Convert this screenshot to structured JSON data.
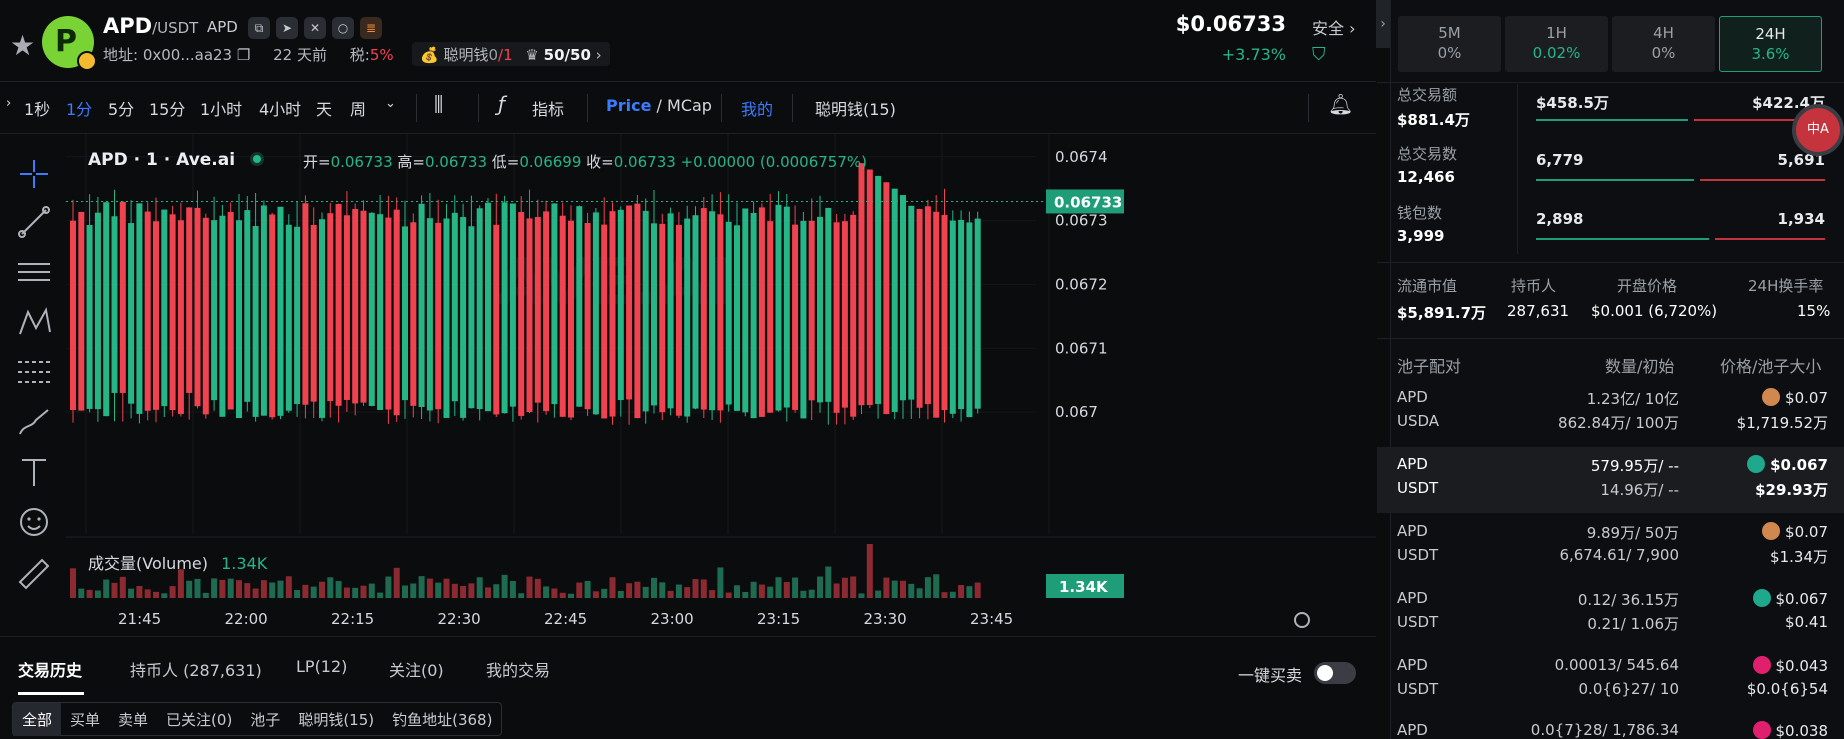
{
  "header": {
    "base": "APD",
    "quote": "/USDT",
    "symbol_tag": "APD",
    "address_label": "地址: 0x00...aa23",
    "age": "22 天前",
    "tax_label": "税:",
    "tax_value": "5%",
    "smart_money_label": "聪明钱",
    "smart_money_a": "0",
    "smart_money_b": "/1",
    "holders_ratio": "50/50",
    "price": "$0.06733",
    "change": "+3.73%",
    "safety": "安全"
  },
  "toolbar": {
    "intervals": [
      "1秒",
      "1分",
      "5分",
      "15分",
      "1小时",
      "4小时",
      "天",
      "周"
    ],
    "active_interval": "1分",
    "indicators": "指标",
    "price_mode": "Price",
    "mcap_mode": "/ MCap",
    "mine": "我的",
    "smart_money": "聪明钱(15)"
  },
  "chart": {
    "legend": "APD · 1 · Ave.ai",
    "open_label": "开=",
    "open": "0.06733",
    "high_label": "高=",
    "high": "0.06733",
    "low_label": "低=",
    "low": "0.06699",
    "close_label": "收=",
    "close": "0.06733",
    "change": "+0.00000 (0.0006757%)",
    "volume_label": "成交量(Volume)",
    "volume_value": "1.34K",
    "current_price_tag": "0.06733",
    "current_volume_tag": "1.34K",
    "watermark": "AVE.AI"
  },
  "chart_data": {
    "type": "candlestick",
    "y_ticks": [
      "0.0674",
      "0.0673",
      "0.0672",
      "0.0671",
      "0.067"
    ],
    "x_ticks": [
      "21:45",
      "22:00",
      "22:15",
      "22:30",
      "22:45",
      "23:00",
      "23:15",
      "23:30",
      "23:45"
    ],
    "ylim": [
      0.06695,
      0.06742
    ],
    "last_close": 0.06733
  },
  "bottom_tabs": {
    "tabs": [
      "交易历史",
      "持币人 (287,631)",
      "LP(12)",
      "关注(0)",
      "我的交易"
    ],
    "quick_trade": "一键买卖",
    "filters": [
      "全部",
      "买单",
      "卖单",
      "已关注(0)",
      "池子",
      "聪明钱(15)",
      "钓鱼地址(368)"
    ]
  },
  "right": {
    "timeframes": [
      {
        "label": "5M",
        "value": "0%"
      },
      {
        "label": "1H",
        "value": "0.02%"
      },
      {
        "label": "4H",
        "value": "0%"
      },
      {
        "label": "24H",
        "value": "3.6%"
      }
    ],
    "volume_label": "总交易额",
    "volume_value": "$881.4万",
    "volume_buy": "$458.5万",
    "volume_sell": "$422.4万",
    "txns_label": "总交易数",
    "txns_value": "12,466",
    "txns_buy": "6,779",
    "txns_sell": "5,691",
    "wallets_label": "钱包数",
    "wallets_value": "3,999",
    "wallets_buy": "2,898",
    "wallets_sell": "1,934",
    "market": [
      {
        "label": "流通市值",
        "value": "$5,891.7万"
      },
      {
        "label": "持币人",
        "value": "287,631"
      },
      {
        "label": "开盘价格",
        "value": "$0.001 (6,720%)"
      },
      {
        "label": "24H换手率",
        "value": "15%"
      }
    ],
    "pool_headers": [
      "池子配对",
      "数量/初始",
      "价格/池子大小"
    ],
    "pools": [
      {
        "sym1": "APD",
        "amt1": "1.23亿/ 10亿",
        "sym2": "USDA",
        "amt2": "862.84万/ 100万",
        "price": "$0.07",
        "size": "$1,719.52万"
      },
      {
        "sym1": "APD",
        "amt1": "579.95万/ --",
        "sym2": "USDT",
        "amt2": "14.96万/ --",
        "price": "$0.067",
        "size": "$29.93万"
      },
      {
        "sym1": "APD",
        "amt1": "9.89万/ 50万",
        "sym2": "USDT",
        "amt2": "6,674.61/ 7,900",
        "price": "$0.07",
        "size": "$1.34万"
      },
      {
        "sym1": "APD",
        "amt1": "0.12/ 36.15万",
        "sym2": "USDT",
        "amt2": "0.21/ 1.06万",
        "price": "$0.067",
        "size": "$0.41"
      },
      {
        "sym1": "APD",
        "amt1": "0.00013/ 545.64",
        "sym2": "USDT",
        "amt2": "0.0{6}27/ 10",
        "price": "$0.043",
        "size": "$0.0{6}54"
      },
      {
        "sym1": "APD",
        "amt1": "0.0{7}28/ 1,786.34",
        "price": "$0.038"
      }
    ]
  },
  "colors": {
    "up": "#26b686",
    "down": "#f0434f",
    "accent": "#3b7bff"
  }
}
